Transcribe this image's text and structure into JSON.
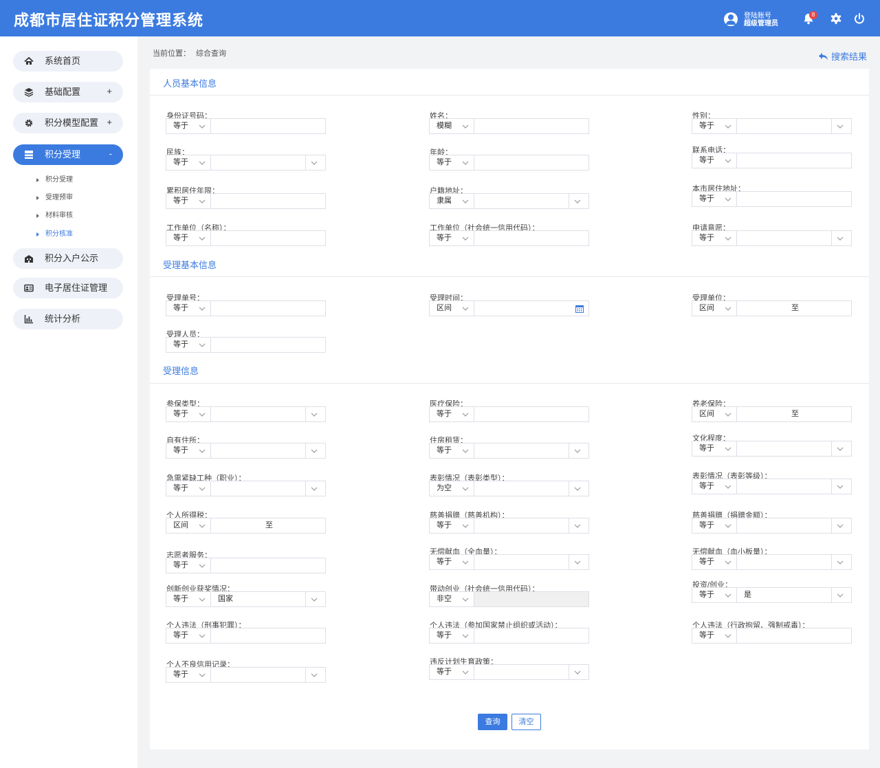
{
  "header": {
    "title": "成都市居住证积分管理系统",
    "user_label": "登陆账号",
    "user_name": "超级管理员",
    "notification_count": "8"
  },
  "sidebar": {
    "items": [
      {
        "label": "系统首页",
        "icon": "home-icon",
        "toggle": ""
      },
      {
        "label": "基础配置",
        "icon": "layers-icon",
        "toggle": "+"
      },
      {
        "label": "积分模型配置",
        "icon": "gear-icon",
        "toggle": "+"
      },
      {
        "label": "积分受理",
        "icon": "inbox-icon",
        "toggle": "-"
      },
      {
        "label": "积分入户公示",
        "icon": "building-icon",
        "toggle": ""
      },
      {
        "label": "电子居住证管理",
        "icon": "id-card-icon",
        "toggle": ""
      },
      {
        "label": "统计分析",
        "icon": "bar-chart-icon",
        "toggle": ""
      }
    ],
    "sub_items": [
      "积分受理",
      "受理预审",
      "材料审核",
      "积分核准"
    ],
    "active_sub_item": "积分核准"
  },
  "breadcrumb": {
    "prefix": "当前位置：",
    "current": "综合查询"
  },
  "results_link": "搜索结果",
  "sections": [
    "人员基本信息",
    "受理基本信息",
    "受理信息"
  ],
  "fields": [
    {
      "label": "身份证号码：",
      "op": "等于",
      "value": "",
      "kind": "text"
    },
    {
      "label": "姓名：",
      "op": "模糊",
      "value": "",
      "kind": "text"
    },
    {
      "label": "性别：",
      "op": "等于",
      "value": "",
      "kind": "select"
    },
    {
      "label": "民族：",
      "op": "等于",
      "value": "",
      "kind": "select"
    },
    {
      "label": "年龄：",
      "op": "等于",
      "value": "",
      "kind": "text"
    },
    {
      "label": "联系电话：",
      "op": "等于",
      "value": "",
      "kind": "text"
    },
    {
      "label": "累积居住年限：",
      "op": "等于",
      "value": "",
      "kind": "text"
    },
    {
      "label": "户籍地址：",
      "op": "隶属",
      "value": "",
      "kind": "select"
    },
    {
      "label": "本市居住地址：",
      "op": "等于",
      "value": "",
      "kind": "text"
    },
    {
      "label": "工作单位（名称）：",
      "op": "等于",
      "value": "",
      "kind": "text"
    },
    {
      "label": "工作单位（社会统一信用代码）：",
      "op": "等于",
      "value": "",
      "kind": "text"
    },
    {
      "label": "申请意愿：",
      "op": "等于",
      "value": "",
      "kind": "select"
    },
    {
      "label": "受理单号：",
      "op": "等于",
      "value": "",
      "kind": "text"
    },
    {
      "label": "受理时间：",
      "op": "区间",
      "value": "",
      "kind": "date"
    },
    {
      "label": "受理单位：",
      "op": "区间",
      "value": "至",
      "kind": "range"
    },
    {
      "label": "受理人员：",
      "op": "等于",
      "value": "",
      "kind": "text"
    },
    {
      "label": "参保类型：",
      "op": "等于",
      "value": "",
      "kind": "select"
    },
    {
      "label": "医疗保险：",
      "op": "等于",
      "value": "",
      "kind": "text"
    },
    {
      "label": "养老保险：",
      "op": "区间",
      "value": "至",
      "kind": "range"
    },
    {
      "label": "自有住所：",
      "op": "等于",
      "value": "",
      "kind": "select"
    },
    {
      "label": "住房租赁：",
      "op": "等于",
      "value": "",
      "kind": "select"
    },
    {
      "label": "文化程度：",
      "op": "等于",
      "value": "",
      "kind": "select"
    },
    {
      "label": "急需紧缺工种（职业）：",
      "op": "等于",
      "value": "",
      "kind": "select"
    },
    {
      "label": "表彰情况（表彰类型）：",
      "op": "为空",
      "value": "",
      "kind": "select"
    },
    {
      "label": "表彰情况（表彰等级）：",
      "op": "等于",
      "value": "",
      "kind": "select"
    },
    {
      "label": "个人所得税：",
      "op": "区间",
      "value": "至",
      "kind": "range"
    },
    {
      "label": "慈善捐赠（慈善机构）：",
      "op": "等于",
      "value": "",
      "kind": "select"
    },
    {
      "label": "慈善捐赠（捐赠金额）：",
      "op": "等于",
      "value": "",
      "kind": "select"
    },
    {
      "label": "志愿者服务：",
      "op": "等于",
      "value": "",
      "kind": "text"
    },
    {
      "label": "无偿献血（全血量）：",
      "op": "等于",
      "value": "",
      "kind": "select"
    },
    {
      "label": "无偿献血（血小板量）：",
      "op": "等于",
      "value": "",
      "kind": "select"
    },
    {
      "label": "创新创业获奖情况：",
      "op": "等于",
      "value": "国家",
      "kind": "select"
    },
    {
      "label": "带动创业（社会统一信用代码）：",
      "op": "非空",
      "value": "",
      "kind": "disabled"
    },
    {
      "label": "投资/创业：",
      "op": "等于",
      "value": "是",
      "kind": "select"
    },
    {
      "label": "个人违法（刑事犯罪）：",
      "op": "等于",
      "value": "",
      "kind": "text"
    },
    {
      "label": "个人违法（参加国家禁止组织或活动）：",
      "op": "等于",
      "value": "",
      "kind": "text"
    },
    {
      "label": "个人违法（行政拘留、强制戒毒）：",
      "op": "等于",
      "value": "",
      "kind": "text"
    },
    {
      "label": "个人不良信用记录：",
      "op": "等于",
      "value": "",
      "kind": "select"
    },
    {
      "label": "违反计划生育政策：",
      "op": "等于",
      "value": "",
      "kind": "select"
    }
  ],
  "buttons": {
    "query": "查询",
    "clear": "清空"
  },
  "colors": {
    "primary": "#3b7be0",
    "badge": "#e54848",
    "sidebar_pill": "#eef1f7"
  }
}
